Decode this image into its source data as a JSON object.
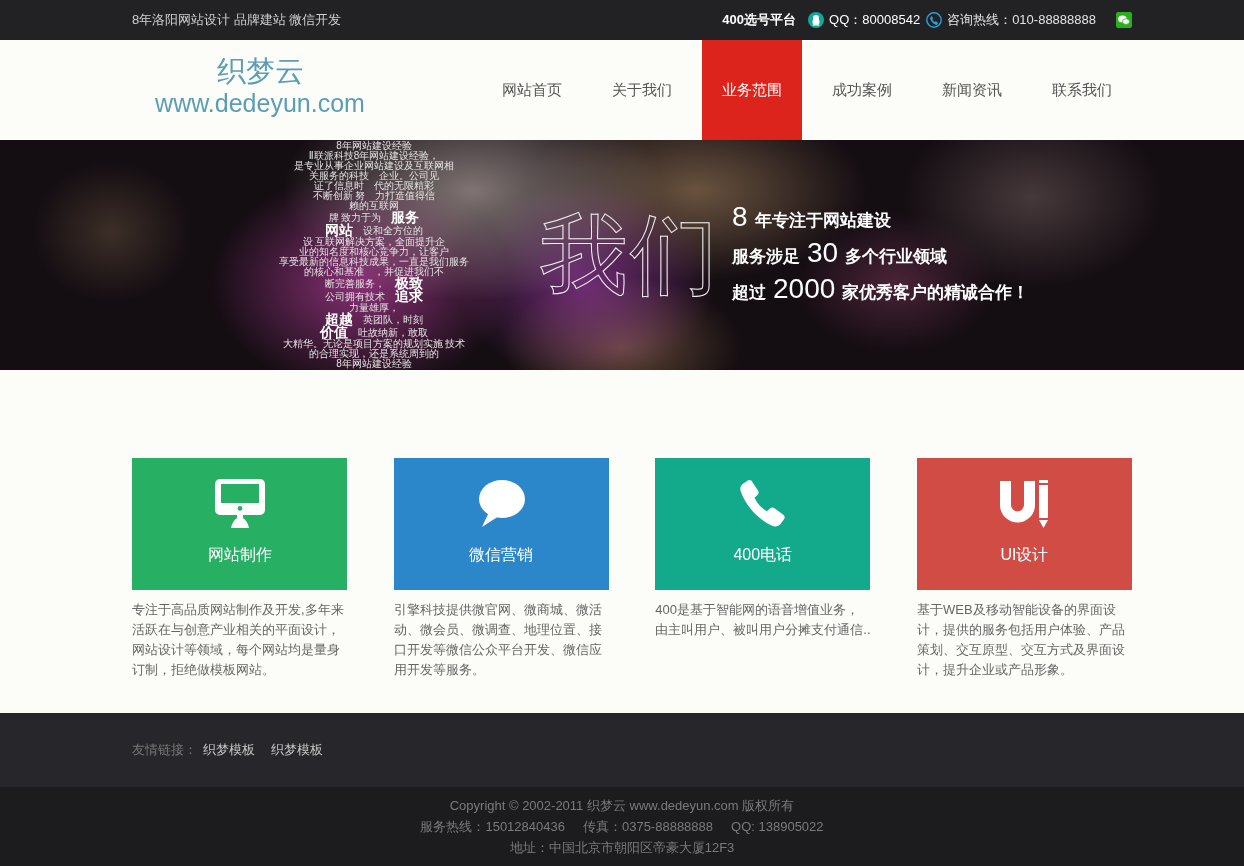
{
  "top_bar": {
    "tagline": "8年洛阳网站设计 品牌建站 微信开发",
    "platform_link": "400选号平台",
    "qq": "QQ：80008542",
    "hotline": "咨询热线：010-88888888"
  },
  "header": {
    "logo_name": "织梦云",
    "logo_url": "www.dedeyun.com",
    "nav": [
      {
        "label": "网站首页",
        "selected": false
      },
      {
        "label": "关于我们",
        "selected": false
      },
      {
        "label": "业务范围",
        "selected": true
      },
      {
        "label": "成功案例",
        "selected": false
      },
      {
        "label": "新闻资讯",
        "selected": false
      },
      {
        "label": "联系我们",
        "selected": false
      }
    ]
  },
  "banner": {
    "word_cloud": [
      [
        {
          "kind": "plain",
          "text": "8年网站建设经验"
        }
      ],
      [
        {
          "kind": "plain",
          "text": "Ⅱ联派科技8年网站建设经验，"
        }
      ],
      [
        {
          "kind": "plain",
          "text": "是专业从事企业网站建设及互联网相"
        }
      ],
      [
        {
          "kind": "plain",
          "text": "关服务的科技"
        },
        {
          "kind": "plain",
          "text": "企业。公司见"
        }
      ],
      [
        {
          "kind": "plain",
          "text": "证了信息时"
        },
        {
          "kind": "plain",
          "text": "代的无限精彩"
        }
      ],
      [
        {
          "kind": "plain",
          "text": "不断创新 努"
        },
        {
          "kind": "plain",
          "text": "力打造值得信"
        }
      ],
      [
        {
          "kind": "plain",
          "text": "赖的互联网"
        }
      ],
      [
        {
          "kind": "plain",
          "text": "牌 致力于为"
        },
        {
          "kind": "emphasis",
          "text": "服务"
        }
      ],
      [
        {
          "kind": "emphasis",
          "text": "网站"
        },
        {
          "kind": "plain",
          "text": "设和全方位的"
        }
      ],
      [
        {
          "kind": "plain",
          "text": "设 互联网解决方案，全面提升企"
        }
      ],
      [
        {
          "kind": "plain",
          "text": "业的知名度和核心竞争力，让客户"
        }
      ],
      [
        {
          "kind": "plain",
          "text": "享受最新的信息科技成果，一直是我们服务"
        }
      ],
      [
        {
          "kind": "plain",
          "text": "的核心和基准"
        },
        {
          "kind": "plain",
          "text": "，并促进我们不"
        }
      ],
      [
        {
          "kind": "plain",
          "text": "断完善服务，"
        },
        {
          "kind": "emphasis",
          "text": "极致"
        }
      ],
      [
        {
          "kind": "plain",
          "text": "公司拥有技术"
        },
        {
          "kind": "emphasis",
          "text": "追求"
        }
      ],
      [
        {
          "kind": "plain",
          "text": "力量雄厚，"
        }
      ],
      [
        {
          "kind": "emphasis",
          "text": "超越"
        },
        {
          "kind": "plain",
          "text": "英团队，时刻"
        }
      ],
      [
        {
          "kind": "emphasis",
          "text": "价值"
        },
        {
          "kind": "plain",
          "text": "吐故纳新，敢取"
        }
      ],
      [
        {
          "kind": "plain",
          "text": "大精华。无论是项目方案的规划实施 技术"
        }
      ],
      [
        {
          "kind": "plain",
          "text": "的合理实现，还是系统周到的"
        }
      ],
      [
        {
          "kind": "plain",
          "text": "8年网站建设经验"
        }
      ]
    ],
    "headline": "我们",
    "slogan": [
      [
        {
          "kind": "number",
          "text": "8"
        },
        {
          "kind": "text",
          "text": "年专注于网站建设"
        }
      ],
      [
        {
          "kind": "text",
          "text": "服务涉足"
        },
        {
          "kind": "number",
          "text": "30"
        },
        {
          "kind": "text",
          "text": "多个行业领域"
        }
      ],
      [
        {
          "kind": "text",
          "text": "超过"
        },
        {
          "kind": "number",
          "text": "2000"
        },
        {
          "kind": "text",
          "text": "家优秀客户的精诚合作！"
        }
      ]
    ]
  },
  "services": [
    {
      "title": "网站制作",
      "color": "#27b064",
      "description": "专注于高品质网站制作及开发,多年来活跃在与创意产业相关的平面设计，网站设计等领域，每个网站均是量身订制，拒绝做模板网站。"
    },
    {
      "title": "微信营销",
      "color": "#2b87c9",
      "description": "引擎科技提供微官网、微商城、微活动、微会员、微调查、地理位置、接口开发等微信公众平台开发、微信应用开发等服务。"
    },
    {
      "title": "400电话",
      "color": "#13a98b",
      "description": "400是基于智能网的语音增值业务，由主叫用户、被叫用户分摊支付通信.."
    },
    {
      "title": "UI设计",
      "color": "#d04c44",
      "description": "基于WEB及移动智能设备的界面设计，提供的服务包括用户体验、产品策划、交互原型、交互方式及界面设计，提升企业或产品形象。"
    }
  ],
  "footer": {
    "links_label": "友情链接：",
    "links": [
      "织梦模板",
      "织梦模板"
    ],
    "copyright": "Copyright © 2002-2011 织梦云 www.dedeyun.com 版权所有",
    "contacts": [
      "服务热线：15012840436",
      "传真：0375-88888888",
      "QQ: 138905022"
    ],
    "address": "地址：中国北京市朝阳区帝豪大厦12F3"
  }
}
